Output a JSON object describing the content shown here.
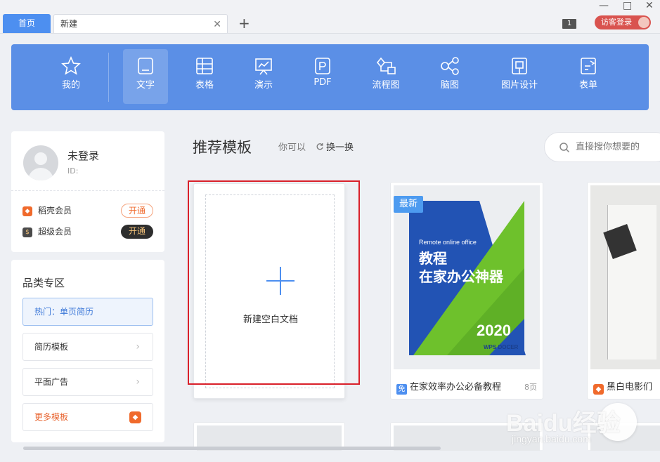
{
  "tabs": {
    "home": "首页",
    "current": "新建",
    "close_glyph": "✕",
    "add_glyph": "+"
  },
  "titlebar": {
    "badge": "1",
    "login": "访客登录",
    "minimize": "—",
    "maximize": "□",
    "close": "✕"
  },
  "toolbar": {
    "items": [
      {
        "label": "我的",
        "icon": "star-icon"
      },
      {
        "label": "文字",
        "icon": "document-icon",
        "active": true
      },
      {
        "label": "表格",
        "icon": "table-icon"
      },
      {
        "label": "演示",
        "icon": "presentation-icon"
      },
      {
        "label": "PDF",
        "icon": "pdf-icon"
      },
      {
        "label": "流程图",
        "icon": "flowchart-icon"
      },
      {
        "label": "脑图",
        "icon": "mindmap-icon"
      },
      {
        "label": "图片设计",
        "icon": "image-design-icon"
      },
      {
        "label": "表单",
        "icon": "form-icon"
      }
    ],
    "background": "#5b8fe6"
  },
  "user": {
    "name": "未登录",
    "id_label": "ID:",
    "vip1": {
      "label": "稻壳会员",
      "button": "开通",
      "color": "#f06a2c"
    },
    "vip2": {
      "label": "超级会员",
      "button": "开通",
      "color": "#333333"
    }
  },
  "categories": {
    "title": "品类专区",
    "items": [
      {
        "label": "热门：单页简历"
      },
      {
        "label": "简历模板"
      },
      {
        "label": "平面广告"
      },
      {
        "label": "更多模板"
      }
    ]
  },
  "main": {
    "title": "推荐模板",
    "subtitle": "你可以",
    "refresh": "换一换",
    "search_placeholder": "直接搜你想要的"
  },
  "templates": {
    "blank_label": "新建空白文档",
    "t2": {
      "tag": "最新",
      "cover_sub": "Remote online office",
      "cover_line1": "教程",
      "cover_line2": "在家办公神器",
      "cover_year": "2020",
      "cover_brand": "WPS DOCER",
      "free_badge": "免",
      "title": "在家效率办公必备教程",
      "pages": "8页"
    },
    "t3": {
      "title": "黑白电影们"
    }
  },
  "watermark": {
    "brand": "Baidu经验",
    "url": "jingyan.baidu.com"
  },
  "colors": {
    "accent": "#4d8ff0",
    "highlight": "#d9202a",
    "orange": "#f06a2c"
  }
}
